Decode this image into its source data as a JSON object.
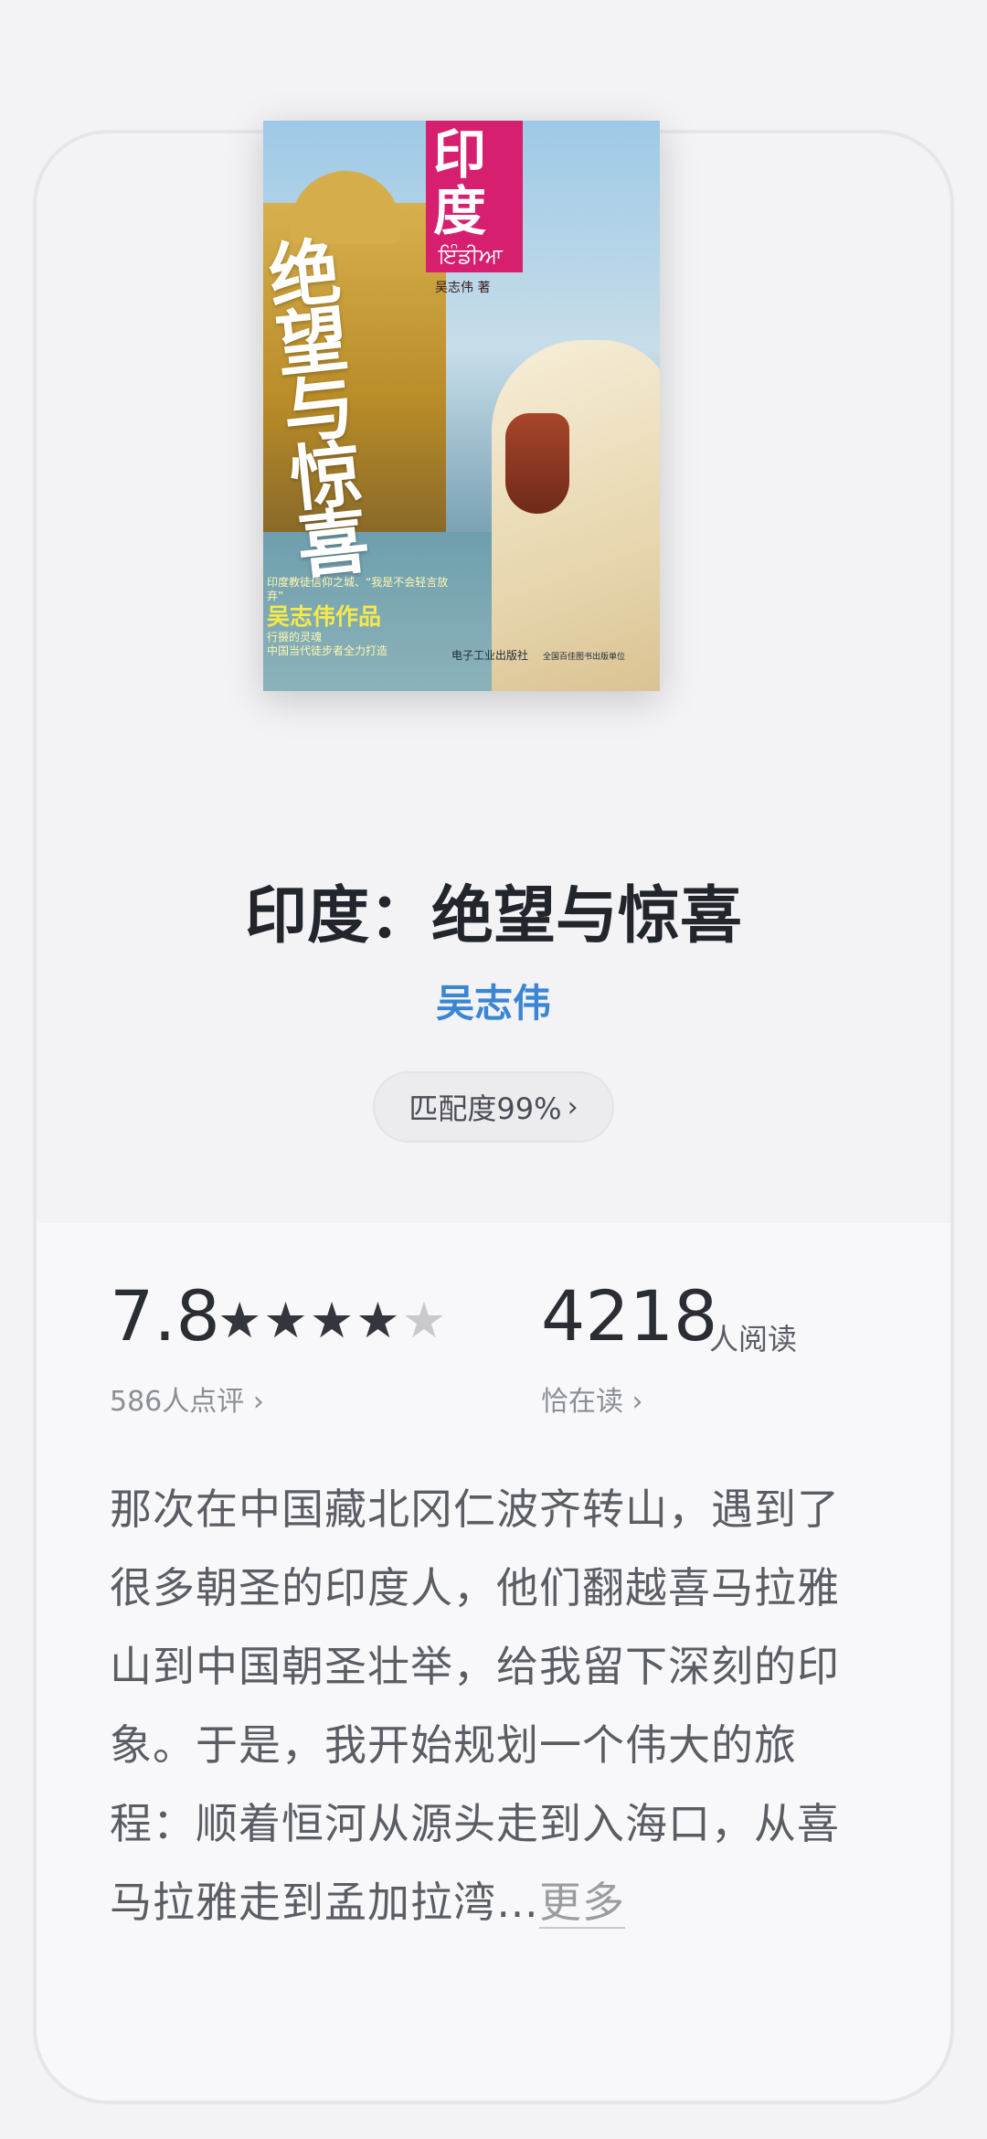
{
  "book": {
    "title": "印度：绝望与惊喜",
    "author": "吴志伟",
    "match": "匹配度99%",
    "match_chevron": "›"
  },
  "cover": {
    "india_label": "印度",
    "hindi_label": "ਇੰਡੀਆ",
    "author_line": "吴志伟 著",
    "calligraphy": "绝望与惊喜",
    "series_top": "印度教徒信仰之城、“我是不会轻言放弃”",
    "series_big": "吴志伟作品",
    "series_mid": "行摄的灵魂",
    "series_bottom": "中国当代徒步者全力打造",
    "publisher": "电子工业出版社",
    "publisher_sub": "全国百佳图书出版单位"
  },
  "rating": {
    "score": "7.8",
    "stars_filled": 4,
    "stars_total": 5,
    "count_label": "586人点评",
    "chevron": "›"
  },
  "readers": {
    "count": "4218",
    "unit": "人阅读",
    "status_label": "恰在读",
    "chevron": "›"
  },
  "description": {
    "text": "那次在中国藏北冈仁波齐转山，遇到了很多朝圣的印度人，他们翻越喜马拉雅山到中国朝圣壮举，给我留下深刻的印象。于是，我开始规划一个伟大的旅程：顺着恒河从源头走到入海口，从喜马拉雅走到孟加拉湾…",
    "more_label": "更多"
  },
  "colors": {
    "accent": "#3a86d4",
    "cover_pink": "#d71f6f",
    "star_on": "#33363d",
    "star_off": "#c9c9cc"
  }
}
